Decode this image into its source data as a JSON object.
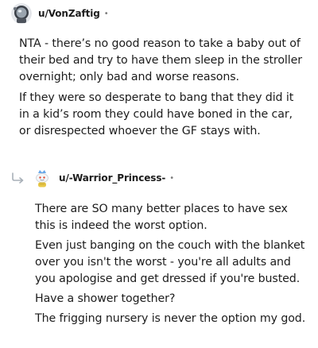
{
  "comments": [
    {
      "username": "u/VonZaftig",
      "separator": "•",
      "avatar_icon": "astronaut-helmet-icon",
      "paragraphs": [
        "NTA - there’s no good reason to take a baby out of their bed and try to have them sleep in the stroller overnight; only bad and worse reasons.",
        "If they were so desperate to bang that they did it in a kid’s room they could have boned in the car, or disrespected whoever the GF stays with."
      ]
    },
    {
      "username": "u/-Warrior_Princess-",
      "separator": "•",
      "avatar_icon": "snoo-with-crown-icon",
      "reply_icon": "reply-arrow-icon",
      "paragraphs": [
        "There are SO many better places to have sex this is indeed the worst option.",
        "Even just banging on the couch with the blanket over you isn't the worst - you're all adults and you apologise and get dressed if you're busted.",
        "Have a shower together?",
        "The frigging nursery is never the option my god."
      ]
    }
  ],
  "colors": {
    "text": "#1c1c1c",
    "meta": "#7c7c7c",
    "reply_arrow": "#a8b0b8"
  }
}
